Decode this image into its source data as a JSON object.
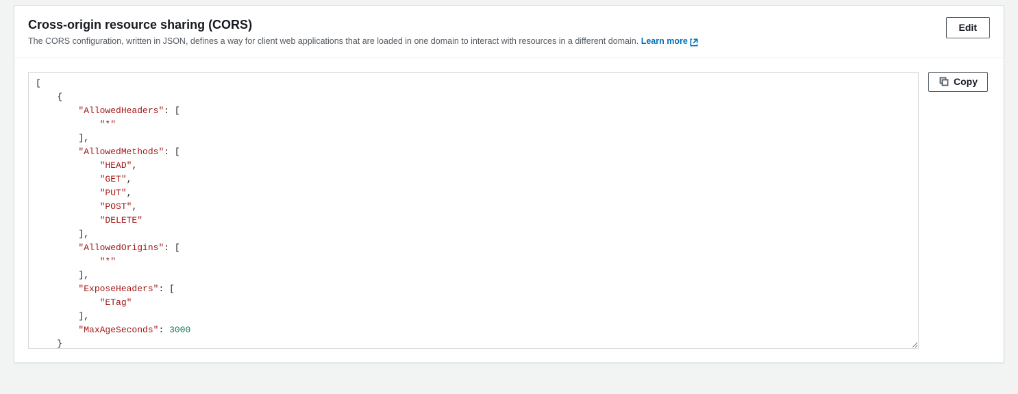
{
  "header": {
    "title": "Cross-origin resource sharing (CORS)",
    "description": "The CORS configuration, written in JSON, defines a way for client web applications that are loaded in one domain to interact with resources in a different domain.",
    "learn_more_label": "Learn more"
  },
  "buttons": {
    "edit": "Edit",
    "copy": "Copy"
  },
  "cors_config": [
    {
      "AllowedHeaders": [
        "*"
      ],
      "AllowedMethods": [
        "HEAD",
        "GET",
        "PUT",
        "POST",
        "DELETE"
      ],
      "AllowedOrigins": [
        "*"
      ],
      "ExposeHeaders": [
        "ETag"
      ],
      "MaxAgeSeconds": 3000
    }
  ]
}
